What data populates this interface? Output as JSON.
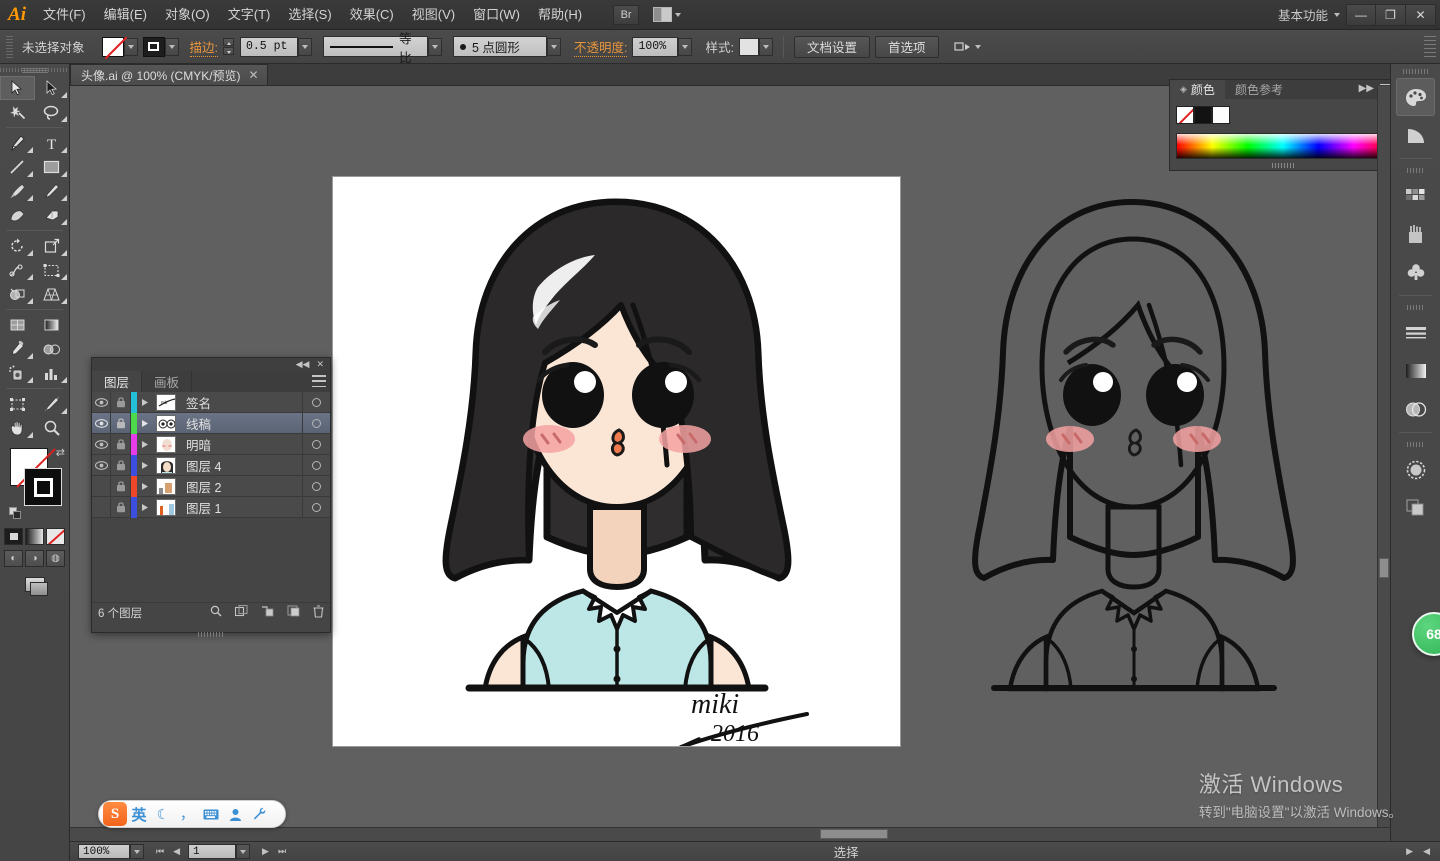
{
  "app": {
    "name": "Adobe Illustrator",
    "logo_text": "Ai",
    "workspace": "基本功能",
    "bridge_button": "Br"
  },
  "menu": {
    "items": [
      {
        "label": "文件(F)",
        "name": "menu-file"
      },
      {
        "label": "编辑(E)",
        "name": "menu-edit"
      },
      {
        "label": "对象(O)",
        "name": "menu-object"
      },
      {
        "label": "文字(T)",
        "name": "menu-type"
      },
      {
        "label": "选择(S)",
        "name": "menu-select"
      },
      {
        "label": "效果(C)",
        "name": "menu-effect"
      },
      {
        "label": "视图(V)",
        "name": "menu-view"
      },
      {
        "label": "窗口(W)",
        "name": "menu-window"
      },
      {
        "label": "帮助(H)",
        "name": "menu-help"
      }
    ]
  },
  "window_controls": {
    "minimize": "—",
    "restore": "❐",
    "close": "✕"
  },
  "control_bar": {
    "selection_status": "未选择对象",
    "fill_label": "填色",
    "stroke_label": "描边:",
    "stroke_weight": "0.5 pt",
    "stroke_profile": "等比",
    "brush_definition": "5 点圆形",
    "opacity_label": "不透明度:",
    "opacity_value": "100%",
    "style_label": "样式:",
    "doc_setup_button": "文档设置",
    "preferences_button": "首选项"
  },
  "document_tab": {
    "title": "头像.ai @ 100% (CMYK/预览)",
    "close": "✕"
  },
  "toolbar": {
    "tools": [
      {
        "name": "selection-tool",
        "label": "选择工具",
        "selected": true
      },
      {
        "name": "direct-selection-tool",
        "label": "直接选择工具",
        "selected": false
      },
      {
        "name": "magic-wand-tool",
        "label": "魔棒工具",
        "selected": false
      },
      {
        "name": "lasso-tool",
        "label": "套索工具",
        "selected": false
      },
      {
        "name": "pen-tool",
        "label": "钢笔工具",
        "selected": false
      },
      {
        "name": "type-tool",
        "label": "文字工具",
        "selected": false
      },
      {
        "name": "line-segment-tool",
        "label": "直线段工具",
        "selected": false
      },
      {
        "name": "rectangle-tool",
        "label": "矩形工具",
        "selected": false
      },
      {
        "name": "paintbrush-tool",
        "label": "画笔工具",
        "selected": false
      },
      {
        "name": "pencil-tool",
        "label": "铅笔工具",
        "selected": false
      },
      {
        "name": "blob-brush-tool",
        "label": "斑点画笔工具",
        "selected": false
      },
      {
        "name": "eraser-tool",
        "label": "橡皮擦工具",
        "selected": false
      },
      {
        "name": "rotate-tool",
        "label": "旋转工具",
        "selected": false
      },
      {
        "name": "scale-tool",
        "label": "比例缩放工具",
        "selected": false
      },
      {
        "name": "width-tool",
        "label": "宽度工具",
        "selected": false
      },
      {
        "name": "free-transform-tool",
        "label": "自由变换工具",
        "selected": false
      },
      {
        "name": "shape-builder-tool",
        "label": "形状生成器工具",
        "selected": false
      },
      {
        "name": "perspective-grid-tool",
        "label": "透视网格工具",
        "selected": false
      },
      {
        "name": "mesh-tool",
        "label": "网格工具",
        "selected": false
      },
      {
        "name": "gradient-tool",
        "label": "渐变工具",
        "selected": false
      },
      {
        "name": "eyedropper-tool",
        "label": "吸管工具",
        "selected": false
      },
      {
        "name": "blend-tool",
        "label": "混合工具",
        "selected": false
      },
      {
        "name": "symbol-sprayer-tool",
        "label": "符号喷枪工具",
        "selected": false
      },
      {
        "name": "column-graph-tool",
        "label": "柱形图工具",
        "selected": false
      },
      {
        "name": "artboard-tool",
        "label": "画板工具",
        "selected": false
      },
      {
        "name": "slice-tool",
        "label": "切片工具",
        "selected": false
      },
      {
        "name": "hand-tool",
        "label": "抓手工具",
        "selected": false
      },
      {
        "name": "zoom-tool",
        "label": "缩放工具",
        "selected": false
      }
    ],
    "fill_stroke": {
      "fill": "none",
      "stroke": "#000000",
      "swap_label": "互换填色和描边",
      "default_label": "默认填色和描边"
    },
    "draw_modes": [
      "正常绘图",
      "背面绘图",
      "内部绘图"
    ],
    "screen_mode": "更改屏幕模式"
  },
  "layers_panel": {
    "tabs": [
      {
        "label": "图层",
        "active": true
      },
      {
        "label": "画板",
        "active": false
      }
    ],
    "columns": {
      "visibility": "可见性",
      "lock": "锁定",
      "target": "目标"
    },
    "layers": [
      {
        "name": "签名",
        "color": "#23c0d8",
        "visible": true,
        "locked": false,
        "selected": false
      },
      {
        "name": "线稿",
        "color": "#4cd94c",
        "visible": true,
        "locked": false,
        "selected": true
      },
      {
        "name": "明暗",
        "color": "#e83ce8",
        "visible": true,
        "locked": false,
        "selected": false
      },
      {
        "name": "图层 4",
        "color": "#3b4ede",
        "visible": true,
        "locked": false,
        "selected": false
      },
      {
        "name": "图层 2",
        "color": "#f0472a",
        "visible": false,
        "locked": false,
        "selected": false
      },
      {
        "name": "图层 1",
        "color": "#3b4ede",
        "visible": false,
        "locked": false,
        "selected": false
      }
    ],
    "footer_count": "6 个图层",
    "footer_buttons": [
      {
        "name": "locate-object-button",
        "label": "定位对象"
      },
      {
        "name": "make-clipping-mask-button",
        "label": "建立/释放剪切蒙版"
      },
      {
        "name": "create-new-sublayer-button",
        "label": "创建新子图层"
      },
      {
        "name": "create-new-layer-button",
        "label": "创建新图层"
      },
      {
        "name": "delete-selection-button",
        "label": "删除所选图层"
      }
    ]
  },
  "color_panel": {
    "tabs": [
      {
        "label": "颜色",
        "active": true
      },
      {
        "label": "颜色参考",
        "active": false
      }
    ],
    "swatches": [
      {
        "name": "none-swatch",
        "value": "none"
      },
      {
        "name": "black-swatch",
        "value": "#000000"
      },
      {
        "name": "white-swatch",
        "value": "#ffffff"
      }
    ],
    "spectrum_label": "色谱条"
  },
  "right_dock": {
    "items": [
      {
        "name": "color-panel-icon",
        "label": "颜色",
        "selected": true
      },
      {
        "name": "color-guide-panel-icon",
        "label": "颜色参考",
        "selected": false
      },
      {
        "name": "swatches-panel-icon",
        "label": "色板",
        "selected": false
      },
      {
        "name": "brushes-panel-icon",
        "label": "画笔",
        "selected": false
      },
      {
        "name": "symbols-panel-icon",
        "label": "符号",
        "selected": false
      },
      {
        "name": "stroke-panel-icon",
        "label": "描边",
        "selected": false
      },
      {
        "name": "gradient-panel-icon",
        "label": "渐变",
        "selected": false
      },
      {
        "name": "transparency-panel-icon",
        "label": "透明度",
        "selected": false
      },
      {
        "name": "appearance-panel-icon",
        "label": "外观",
        "selected": false
      },
      {
        "name": "graphic-styles-panel-icon",
        "label": "图形样式",
        "selected": false
      }
    ]
  },
  "status_bar": {
    "zoom_level": "100%",
    "page_number": "1",
    "status_text": "选择",
    "nav_first": "⏮",
    "nav_prev": "◀",
    "nav_next": "▶",
    "nav_last": "⏭"
  },
  "ime_bar": {
    "logo": "S",
    "mode": "英",
    "icons": [
      {
        "name": "moon-icon",
        "glyph": "☾"
      },
      {
        "name": "punctuation-icon",
        "glyph": "，"
      },
      {
        "name": "keyboard-icon",
        "glyph": "⌨"
      },
      {
        "name": "user-icon",
        "glyph": "👤"
      },
      {
        "name": "wrench-icon",
        "glyph": "🔧"
      }
    ]
  },
  "watermark": {
    "line1": "激活 Windows",
    "line2": "转到\"电脑设置\"以激活 Windows。"
  },
  "score_badge": {
    "value": "68"
  },
  "artwork": {
    "signature_text": "miki",
    "signature_year": "2016",
    "colors": {
      "hair": "#2b2b2b",
      "skin": "#f8e0cd",
      "blush": "#f2a5a5",
      "shirt": "#b9e3e3",
      "line": "#111111",
      "lip": "#ef7b4e"
    }
  }
}
